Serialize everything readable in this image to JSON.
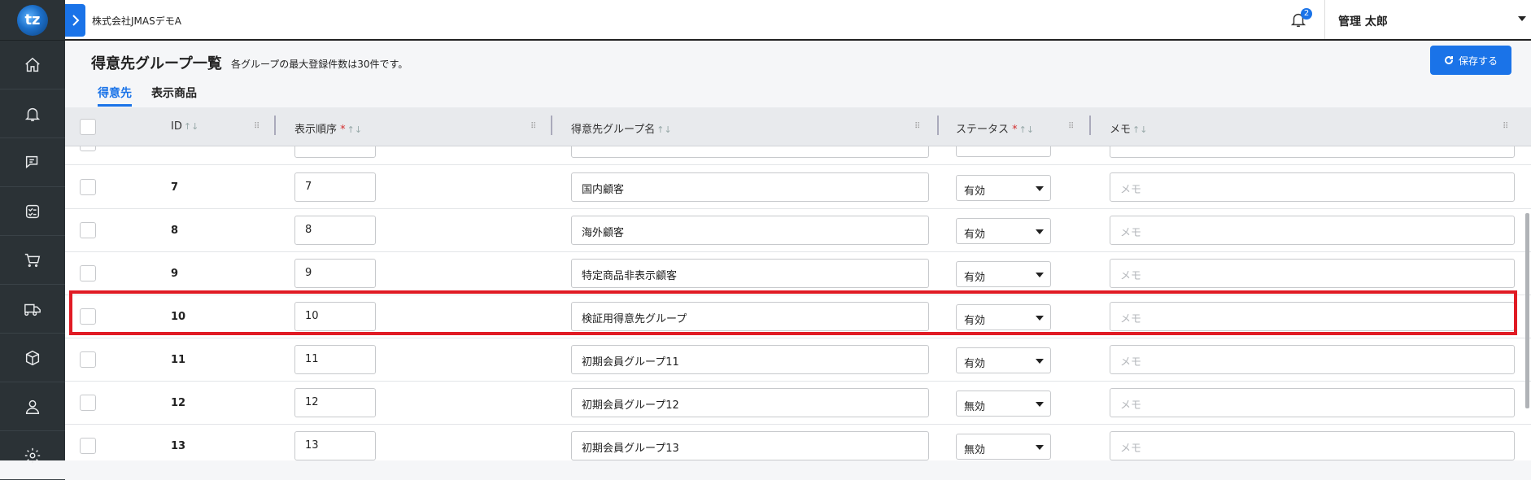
{
  "app": {
    "company": "株式会社JMASデモA",
    "notification_count": "2",
    "user_name": "管理 太郎"
  },
  "sidebar": {
    "logo_text": "tz",
    "items": [
      "home-icon",
      "bell-icon",
      "chat-icon",
      "checklist-icon",
      "cart-icon",
      "truck-icon",
      "box-icon",
      "user-icon",
      "gear-icon"
    ]
  },
  "header": {
    "title": "得意先グループ一覧",
    "subtitle": "各グループの最大登録件数は30件です。",
    "save_label": "保存する"
  },
  "tabs": [
    {
      "label": "得意先",
      "active": true
    },
    {
      "label": "表示商品",
      "active": false
    }
  ],
  "table": {
    "columns": {
      "id": "ID",
      "order": "表示順序",
      "name": "得意先グループ名",
      "status": "ステータス",
      "memo": "メモ"
    },
    "memo_placeholder": "メモ",
    "rows": [
      {
        "id": "7",
        "order": "7",
        "name": "国内顧客",
        "status": "有効"
      },
      {
        "id": "8",
        "order": "8",
        "name": "海外顧客",
        "status": "有効"
      },
      {
        "id": "9",
        "order": "9",
        "name": "特定商品非表示顧客",
        "status": "有効"
      },
      {
        "id": "10",
        "order": "10",
        "name": "検証用得意先グループ",
        "status": "有効"
      },
      {
        "id": "11",
        "order": "11",
        "name": "初期会員グループ11",
        "status": "有効"
      },
      {
        "id": "12",
        "order": "12",
        "name": "初期会員グループ12",
        "status": "無効"
      },
      {
        "id": "13",
        "order": "13",
        "name": "初期会員グループ13",
        "status": "無効"
      }
    ]
  },
  "colors": {
    "accent": "#1a73e8",
    "highlight": "#e01b24",
    "sidebar": "#2b3236"
  }
}
